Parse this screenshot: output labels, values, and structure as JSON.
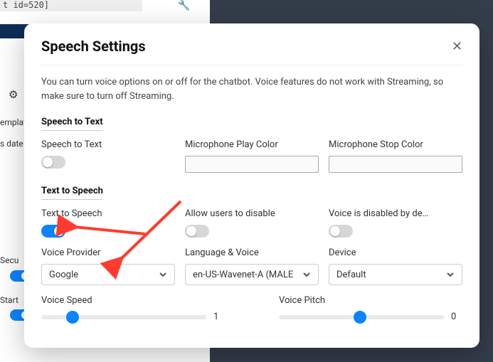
{
  "background": {
    "code_fragment": "t id=520]",
    "label_templates": "emplat",
    "label_dates": "s date",
    "label_secu": "Secu",
    "label_start": "Start"
  },
  "modal": {
    "title": "Speech Settings",
    "description": "You can turn voice options on or off for the chatbot. Voice features do not work with Streaming, so make sure to turn off Streaming.",
    "section_stt": "Speech to Text",
    "section_tts": "Text to Speech",
    "fields": {
      "stt_label": "Speech to Text",
      "mic_play_label": "Microphone Play Color",
      "mic_stop_label": "Microphone Stop Color",
      "tts_label": "Text to Speech",
      "allow_disable_label": "Allow users to disable",
      "voice_disabled_label": "Voice is disabled by de…",
      "voice_provider_label": "Voice Provider",
      "lang_voice_label": "Language & Voice",
      "device_label": "Device",
      "voice_speed_label": "Voice Speed",
      "voice_pitch_label": "Voice Pitch"
    },
    "values": {
      "stt_on": false,
      "tts_on": true,
      "allow_disable_on": false,
      "voice_disabled_on": false,
      "voice_provider": "Google",
      "lang_voice": "en-US-Wavenet-A (MALE",
      "device": "Default",
      "voice_speed": "1",
      "voice_speed_pct": 19,
      "voice_pitch": "0",
      "voice_pitch_pct": 49
    }
  }
}
